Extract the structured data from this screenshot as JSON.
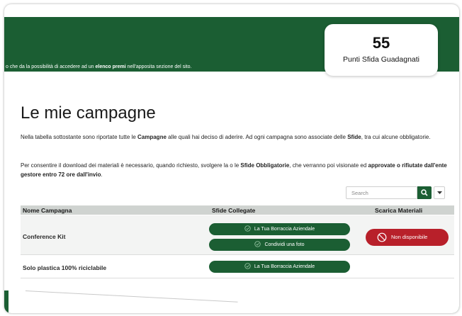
{
  "banner": {
    "text_prefix": "o che da la possibilità di accedere ad un ",
    "text_bold": "elenco premi",
    "text_suffix": " nell'apposita sezione del sito."
  },
  "points": {
    "value": "55",
    "label": "Punti Sfida Guadagnati"
  },
  "page": {
    "title": "Le mie campagne",
    "para1": {
      "a": "Nella tabella sottostante sono riportate tutte le ",
      "b": "Campagne",
      "c": " alle quali hai deciso di aderire. Ad ogni campagna sono associate delle ",
      "d": "Sfide",
      "e": ", tra cui alcune obbligatorie."
    },
    "para2": {
      "a": "Per consentire il download dei materiali è necessario, quando richiesto, svolgere la o le ",
      "b": "Sfide Obbligatorie",
      "c": ", che verranno poi visionate ed ",
      "d": "approvate o rifiutate dall'ente gestore entro 72 ore dall'invio",
      "e": "."
    }
  },
  "search": {
    "placeholder": "Search"
  },
  "table": {
    "headers": {
      "name": "Nome Campagna",
      "challenges": "Sfide Collegate",
      "download": "Scarica Materiali"
    },
    "rows": [
      {
        "name": "Conference Kit",
        "challenges": [
          "La Tua Borraccia Aziendale",
          "Condividi una foto"
        ],
        "download": "Non disponibile"
      },
      {
        "name": "Solo plastica 100% riciclabile",
        "challenges": [
          "La Tua Borraccia Aziendale"
        ],
        "download": ""
      }
    ]
  },
  "colors": {
    "brand_green": "#1b5e33",
    "unavailable_red": "#b8202a"
  }
}
